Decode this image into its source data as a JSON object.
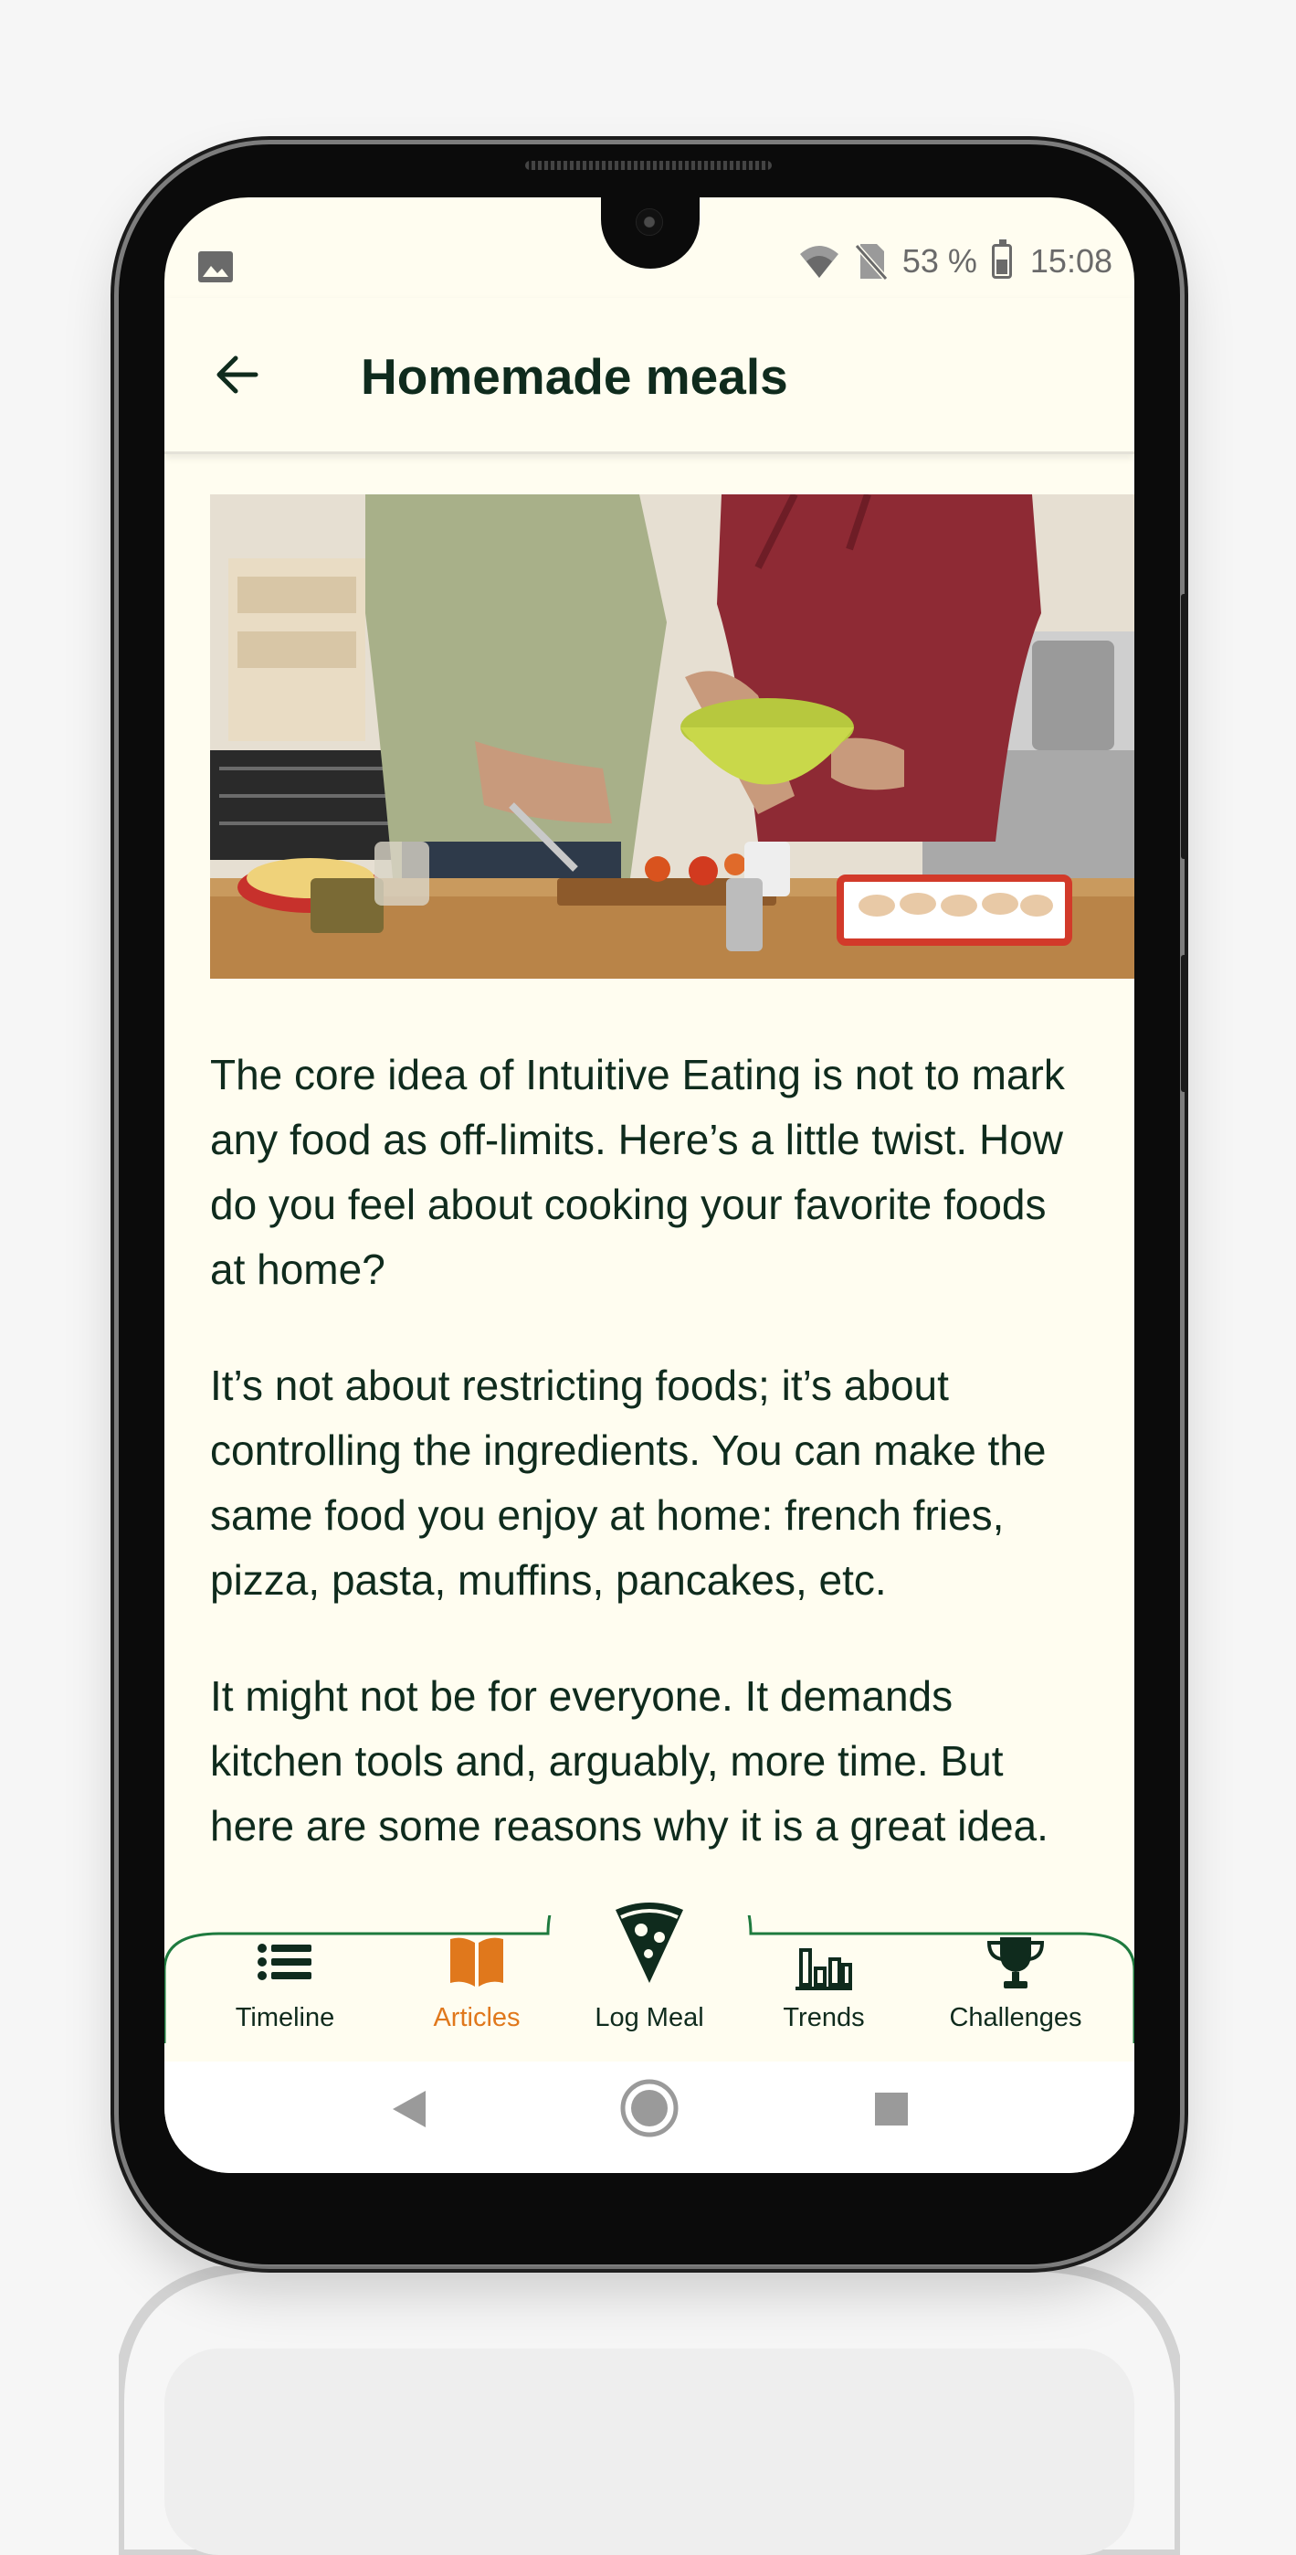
{
  "status_bar": {
    "battery_text": "53 %",
    "time": "15:08"
  },
  "app_bar": {
    "title": "Homemade meals"
  },
  "hero_image": {
    "subject": "two people cooking together at a kitchen counter"
  },
  "article": {
    "paragraphs": [
      "The core idea of Intuitive Eating is not to mark any food as off-limits. Here’s a little twist. How do you feel about cooking your favorite foods at home?",
      "It’s not about restricting foods; it’s about controlling the ingredients. You can make the same food you enjoy at home: french fries, pizza, pasta, muffins, pancakes, etc.",
      "It might not be for everyone. It demands kitchen tools and, arguably, more time. But here are some reasons why it is a great idea."
    ]
  },
  "bottom_nav": {
    "items": [
      {
        "label": "Timeline",
        "icon": "list-icon"
      },
      {
        "label": "Articles",
        "icon": "book-icon",
        "active": true
      },
      {
        "label": "Log Meal",
        "icon": "pizza-icon"
      },
      {
        "label": "Trends",
        "icon": "bar-chart-icon"
      },
      {
        "label": "Challenges",
        "icon": "trophy-icon"
      }
    ]
  },
  "colors": {
    "accent": "#e0781c",
    "primary_text": "#0f2b1d",
    "background": "#fffdf0",
    "nav_border": "#1e7a3e"
  }
}
